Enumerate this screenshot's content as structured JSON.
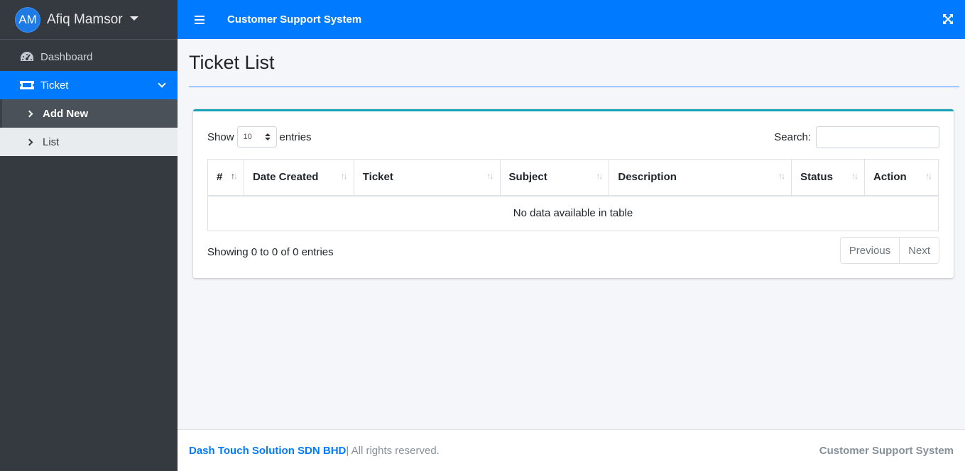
{
  "sidebar": {
    "user_initials": "AM",
    "user_name": "Afiq Mamsor",
    "items": [
      {
        "label": "Dashboard",
        "icon": "tachometer-icon"
      },
      {
        "label": "Ticket",
        "icon": "ticket-icon",
        "active": true
      },
      {
        "label": "Add New",
        "icon": "chevron-right-icon"
      },
      {
        "label": "List",
        "icon": "chevron-right-icon"
      }
    ]
  },
  "topbar": {
    "title": "Customer Support System",
    "menu_icon": "hamburger-icon",
    "fullscreen_icon": "expand-icon"
  },
  "page": {
    "title": "Ticket List"
  },
  "table_controls": {
    "show_label": "Show",
    "page_length": "10",
    "entries_label": "entries",
    "search_label": "Search:",
    "search_value": ""
  },
  "table": {
    "columns": [
      "#",
      "Date Created",
      "Ticket",
      "Subject",
      "Description",
      "Status",
      "Action"
    ],
    "empty_message": "No data available in table"
  },
  "pagination": {
    "info": "Showing 0 to 0 of 0 entries",
    "previous": "Previous",
    "next": "Next"
  },
  "footer": {
    "company": "Dash Touch Solution SDN BHD",
    "rights": "| All rights reserved.",
    "right_text": "Customer Support System"
  },
  "colors": {
    "primary": "#007bff",
    "sidebar_bg": "#343a40",
    "card_accent": "#17a2b8"
  }
}
